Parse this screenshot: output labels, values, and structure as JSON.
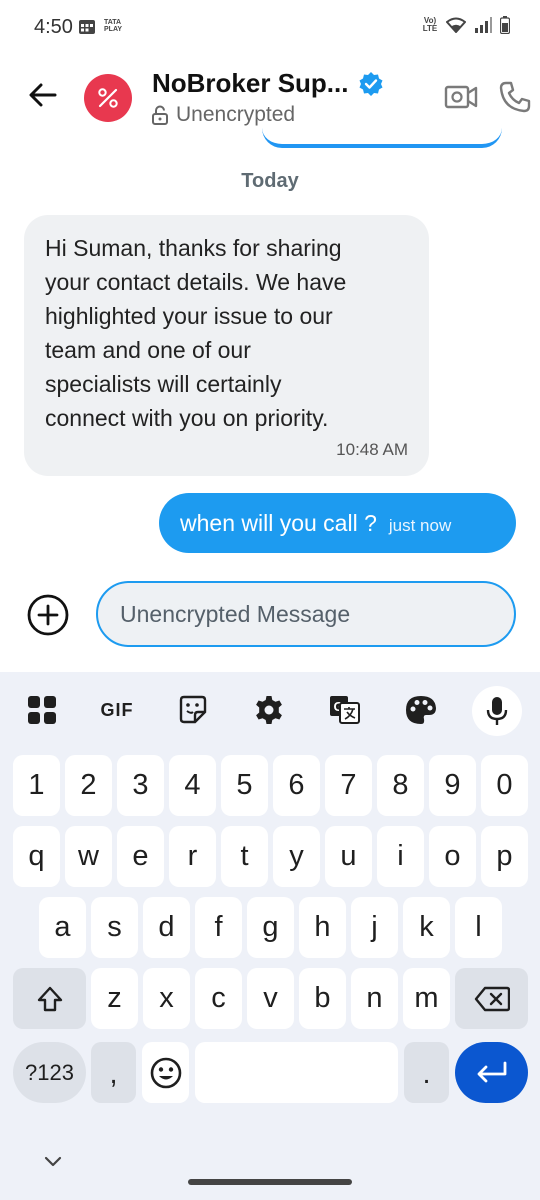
{
  "status_bar": {
    "time": "4:50",
    "carrier_logo": "TATA PLAY",
    "network_label": "Vo) LTE"
  },
  "header": {
    "contact_name": "NoBroker Sup...",
    "subtitle": "Unencrypted",
    "verified": true
  },
  "conversation": {
    "date_separator": "Today",
    "messages": [
      {
        "direction": "incoming",
        "text": "Hi Suman, thanks for sharing your contact details. We have highlighted your issue to our team and one of our specialists will certainly connect with you on priority.",
        "lines": [
          "Hi Suman, thanks for sharing",
          "your contact details. We have",
          "highlighted your issue to our",
          "team and one of our",
          "specialists will certainly",
          "connect with you on priority."
        ],
        "time": "10:48 AM"
      },
      {
        "direction": "outgoing",
        "text": "when will you call ?",
        "time": "just now"
      }
    ]
  },
  "composer": {
    "placeholder": "Unencrypted Message",
    "value": ""
  },
  "keyboard": {
    "toolbar": [
      "apps-icon",
      "gif-icon",
      "sticker-icon",
      "settings-icon",
      "translate-icon",
      "theme-palette-icon",
      "mic-icon"
    ],
    "toolbar_gif_label": "GIF",
    "row_numbers": [
      "1",
      "2",
      "3",
      "4",
      "5",
      "6",
      "7",
      "8",
      "9",
      "0"
    ],
    "row1": [
      "q",
      "w",
      "e",
      "r",
      "t",
      "y",
      "u",
      "i",
      "o",
      "p"
    ],
    "row2": [
      "a",
      "s",
      "d",
      "f",
      "g",
      "h",
      "j",
      "k",
      "l"
    ],
    "row3": [
      "z",
      "x",
      "c",
      "v",
      "b",
      "n",
      "m"
    ],
    "symbols_key": "?123",
    "comma_key": ",",
    "period_key": "."
  },
  "colors": {
    "accent": "#1d9bf0",
    "avatar_bg": "#e8384f",
    "enter_key": "#0b57d0",
    "keyboard_bg": "#eef1f8"
  }
}
